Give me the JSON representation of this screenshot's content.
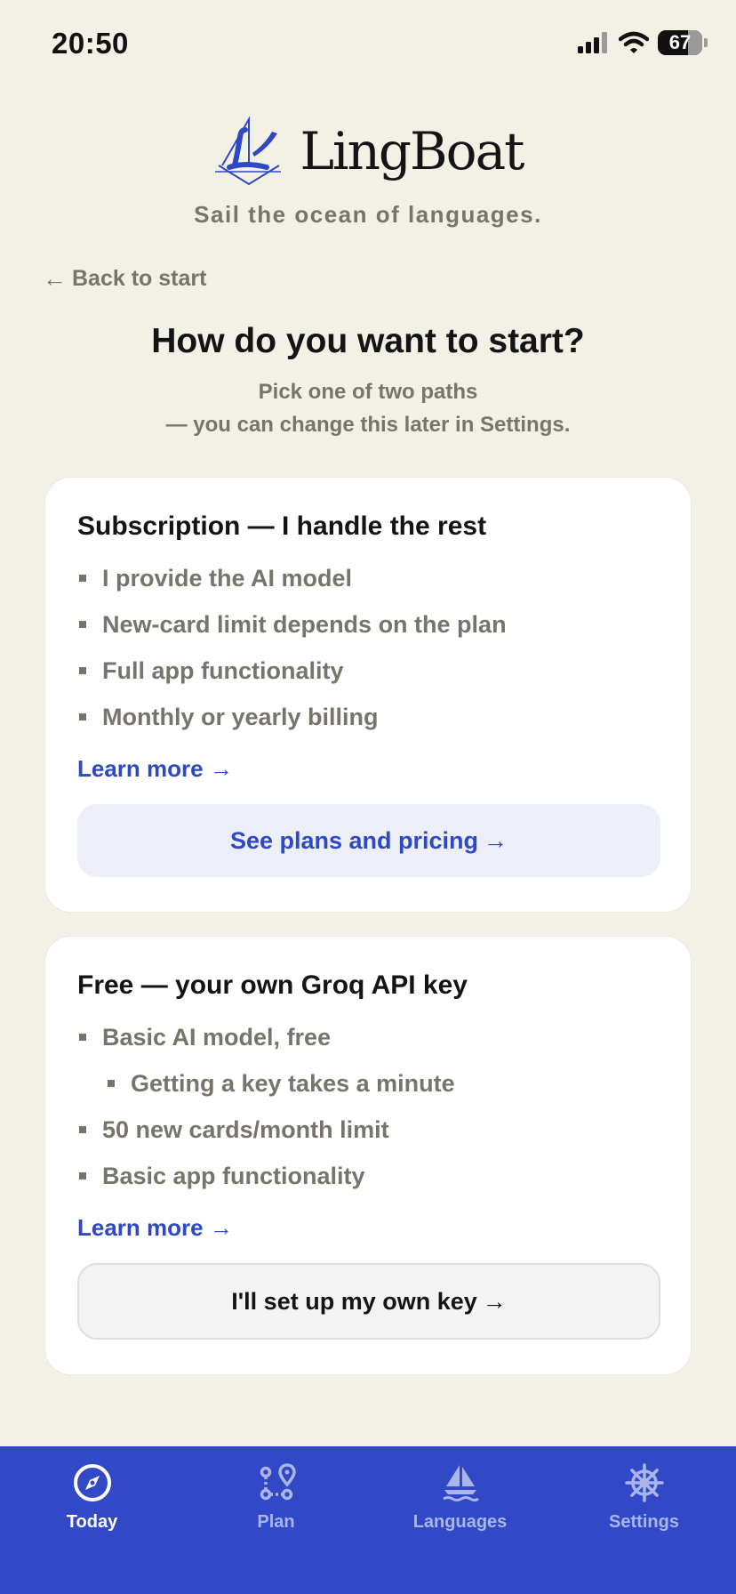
{
  "status_bar": {
    "time": "20:50",
    "battery": "67"
  },
  "brand": {
    "name": "LingBoat",
    "tagline": "Sail the ocean of languages."
  },
  "nav": {
    "back_label": "Back to start",
    "back_arrow": "←"
  },
  "page": {
    "title": "How do you want to start?",
    "subtitle_line1": "Pick one of two paths",
    "subtitle_line2": "— you can change this later in Settings."
  },
  "subscription_card": {
    "title": "Subscription — I handle the rest",
    "features": [
      "I provide the AI model",
      "New-card limit depends on the plan",
      "Full app functionality",
      "Monthly or yearly billing"
    ],
    "learn_more": "Learn more",
    "cta": "See plans and pricing",
    "arrow": "→"
  },
  "free_card": {
    "title": "Free — your own Groq API key",
    "features": [
      "Basic AI model, free",
      "Getting a key takes a minute",
      "50 new cards/month limit",
      "Basic app functionality"
    ],
    "learn_more": "Learn more",
    "cta": "I'll set up my own key",
    "arrow": "→"
  },
  "tab_bar": {
    "tabs": [
      {
        "label": "Today",
        "icon": "compass-icon",
        "active": true
      },
      {
        "label": "Plan",
        "icon": "route-icon",
        "active": false
      },
      {
        "label": "Languages",
        "icon": "sailboat-icon",
        "active": false
      },
      {
        "label": "Settings",
        "icon": "ship-wheel-icon",
        "active": false
      }
    ]
  },
  "colors": {
    "background": "#f3f1e6",
    "accent": "#3149c6",
    "link": "#2f48c4",
    "muted_text": "#77746c"
  }
}
